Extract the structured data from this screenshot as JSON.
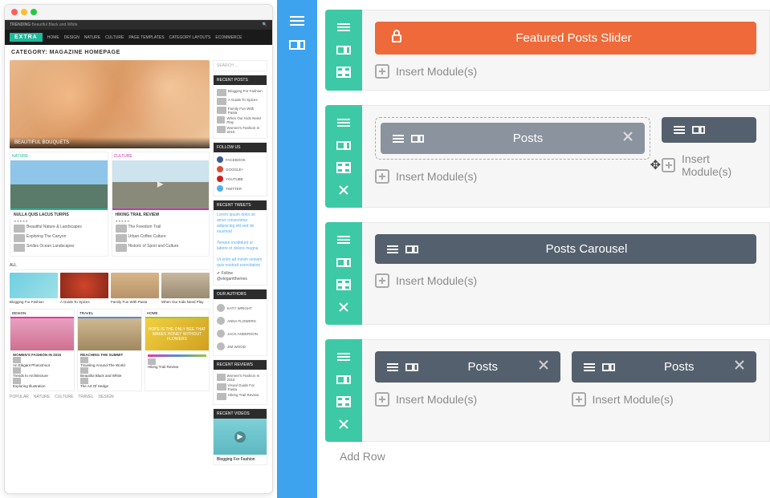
{
  "preview": {
    "topbar_trending": "TRENDING",
    "topbar_text": "Beautiful Black and White",
    "logo": "EXTRA",
    "nav": [
      "HOME",
      "DESIGN",
      "NATURE",
      "CULTURE",
      "PAGE TEMPLATES",
      "CATEGORY LAYOUTS",
      "ECOMMERCE"
    ],
    "category_title": "CATEGORY: MAGAZINE HOMEPAGE",
    "hero_title": "BEAUTIFUL BOUQUETS",
    "cards": [
      {
        "topic": "NATURE",
        "title": "NULLA QUIS LACUS TURPIS",
        "rows": [
          "Beautiful Nature & Landscapes",
          "Exploring The Canyon",
          "Smiles Ocean Landscapes"
        ]
      },
      {
        "topic": "CULTURE",
        "title": "HIKING TRAIL REVIEW",
        "rows": [
          "The Freedom Trail",
          "Urban Coffee Culture",
          "Historic of Sport and Culture"
        ]
      }
    ],
    "all_label": "ALL",
    "grid": [
      {
        "title": "Blogging For Fashion"
      },
      {
        "title": "A Guide To Spices"
      },
      {
        "title": "Family Fun With Pasta"
      },
      {
        "title": "When Our Kids Need Play"
      }
    ],
    "tri": [
      {
        "label": "DESIGN",
        "title": "WOMEN'S FASHION IN 2015",
        "rows": [
          "An Elegant Photoshoot",
          "Trends In Architecture",
          "Exploring Illustration"
        ]
      },
      {
        "label": "TRAVEL",
        "title": "REACHING THE SUMMIT",
        "rows": [
          "Traveling Around The World",
          "Beautiful Black and White",
          "The Art Of Hedge"
        ]
      },
      {
        "label": "HOME",
        "title": "HOPE IS THE ONLY BEE THAT MAKES HONEY WITHOUT FLOWERS",
        "rows": [
          "Hiking Trail Review"
        ]
      }
    ],
    "tabs": [
      "POPULAR",
      "NATURE",
      "CULTURE",
      "TRAVEL",
      "DESIGN"
    ],
    "sidebar": {
      "search": "SEARCH …",
      "recent_posts": "RECENT POSTS",
      "posts": [
        "Blogging For Fashion",
        "A Guide To Spices",
        "Family Fun With Pasta",
        "When Our Kids Need Play",
        "Women's Fashion in 2015"
      ],
      "follow": "FOLLOW US",
      "social": [
        {
          "name": "FACEBOOK",
          "c": "#3b5998"
        },
        {
          "name": "GOOGLE+",
          "c": "#dd4b39"
        },
        {
          "name": "YOUTUBE",
          "c": "#cd201f"
        },
        {
          "name": "TWITTER",
          "c": "#55acee"
        }
      ],
      "tweets": "RECENT TWEETS",
      "follow_btn": "Follow @elegantthemes",
      "authors": "OUR AUTHORS",
      "authors_list": [
        "KATY WRIGHT",
        "ANNA FLOWERS",
        "JACK ANDERSON",
        "JIM WOOD"
      ],
      "reviews": "RECENT REVIEWS",
      "reviews_list": [
        "Women's Fashion in 2015",
        "Visual Guide For Pasta",
        "Hiking Trail Review"
      ],
      "videos": "RECENT VIDEOS",
      "video_title": "Blogging For Fashion"
    }
  },
  "builder": {
    "rows": [
      {
        "columns": [
          {
            "modules": [
              {
                "type": "orange",
                "locked": true,
                "label": "Featured Posts Slider"
              }
            ],
            "insert": "Insert Module(s)"
          }
        ],
        "controls": [
          "hamburger",
          "columns",
          "grid"
        ]
      },
      {
        "columns": [
          {
            "dropzone": true,
            "modules": [
              {
                "type": "grey",
                "label": "Posts",
                "close": true,
                "dragging": true
              }
            ],
            "insert": "Insert Module(s)"
          },
          {
            "modules": [
              {
                "type": "dark",
                "label": "",
                "partial": true
              }
            ],
            "insert": "Insert Module(s)"
          }
        ],
        "controls": [
          "hamburger",
          "columns",
          "grid",
          "close"
        ]
      },
      {
        "columns": [
          {
            "modules": [
              {
                "type": "dark",
                "label": "Posts Carousel"
              }
            ],
            "insert": "Insert Module(s)"
          }
        ],
        "controls": [
          "hamburger",
          "columns",
          "grid",
          "close"
        ]
      },
      {
        "columns": [
          {
            "modules": [
              {
                "type": "dark",
                "label": "Posts",
                "close": true
              }
            ],
            "insert": "Insert Module(s)"
          },
          {
            "modules": [
              {
                "type": "dark",
                "label": "Posts",
                "close": true
              }
            ],
            "insert": "Insert Module(s)"
          }
        ],
        "controls": [
          "hamburger",
          "columns",
          "grid",
          "close"
        ]
      }
    ],
    "addrow": "Add Row"
  }
}
